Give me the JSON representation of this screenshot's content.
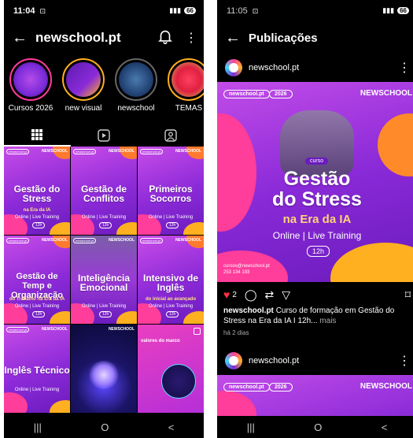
{
  "profile": {
    "status": {
      "time": "11:04",
      "battery": "66"
    },
    "title": "newschool.pt",
    "highlights": [
      {
        "label": "Cursos 2026",
        "color": "#7a2ad8"
      },
      {
        "label": "new visual",
        "color": "#5a1bb0"
      },
      {
        "label": "newschool",
        "color": "#1c3a6a"
      },
      {
        "label": "TEMAS",
        "color": "#e02040"
      }
    ],
    "grid": [
      {
        "title": "Gestão do Stress",
        "sub": "na Era da IA",
        "line": "Online | Live Training",
        "hours": "12h",
        "brand": "NEWSCHOOL",
        "pill": "newschool.pt"
      },
      {
        "title": "Gestão de Conflitos",
        "sub": "",
        "line": "Online | Live Training",
        "hours": "12h",
        "brand": "NEWSCHOOL",
        "pill": "newschool.pt"
      },
      {
        "title": "Primeiros Socorros",
        "sub": "",
        "line": "Online | Live Training",
        "hours": "12h",
        "brand": "NEWSCHOOL",
        "pill": "newschool.pt"
      },
      {
        "title": "Gestão de Temp e Organização",
        "sub": "do Trabalho na Era da IA",
        "line": "Online | Live Training",
        "hours": "12h",
        "brand": "NEWSCHOOL",
        "pill": "newschool.pt"
      },
      {
        "title": "Inteligência Emocional",
        "sub": "",
        "line": "Online | Live Training",
        "hours": "12h",
        "brand": "NEWSCHOOL",
        "pill": "newschool.pt"
      },
      {
        "title": "Intensivo de Inglês",
        "sub": "do inicial ao avançado",
        "line": "Online | Live Training",
        "hours": "12h",
        "brand": "NEWSCHOOL",
        "pill": "newschool.pt"
      },
      {
        "title": "Inglês Técnico",
        "sub": "",
        "line": "Online | Live Training",
        "hours": "",
        "brand": "NEWSCHOOL",
        "pill": "newschool.pt"
      },
      {
        "title": "",
        "sub": "",
        "line": "",
        "hours": "",
        "brand": "NEWSCHOOL",
        "pill": ""
      },
      {
        "title": "",
        "sub": "",
        "line": "",
        "hours": "",
        "brand": "",
        "pill": "valores do marco"
      }
    ],
    "nav": [
      "|||",
      "O",
      "<"
    ]
  },
  "post": {
    "status": {
      "time": "11:05",
      "battery": "66"
    },
    "title": "Publicações",
    "username": "newschool.pt",
    "pill1": "newschool.pt",
    "pill2": "2026",
    "brand": "NEWSCHOOL",
    "curso": "curso",
    "title1": "Gestão",
    "title2": "do Stress",
    "subtitle": "na Era da IA",
    "line": "Online | Live Training",
    "hours": "12h",
    "contact1": "cursos@newschool.pt",
    "contact2": "253 134 193",
    "likes": "2",
    "caption_user": "newschool.pt",
    "caption_text": "Curso de formação em Gestão do Stress na Era da IA I 12h...",
    "caption_more": "mais",
    "time_ago": "há 2 dias",
    "username2": "newschool.pt",
    "nav": [
      "|||",
      "O",
      "<"
    ]
  }
}
